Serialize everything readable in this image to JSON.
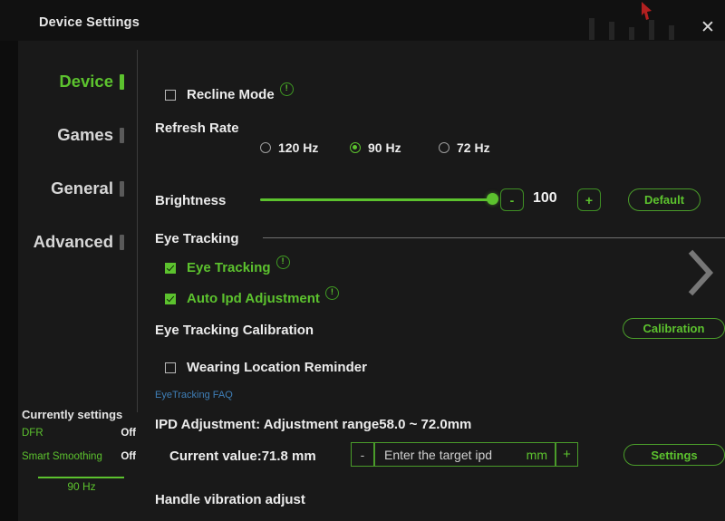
{
  "window": {
    "title": "Device Settings",
    "close_icon": "close-icon"
  },
  "colors": {
    "accent_green": "#5cc22e",
    "panel_bg": "#191919",
    "app_bg": "#0d0d0d",
    "text": "#ececec",
    "link_blue": "#3f7fb8"
  },
  "sidebar": {
    "items": [
      {
        "label": "Device",
        "active": true
      },
      {
        "label": "Games",
        "active": false
      },
      {
        "label": "General",
        "active": false
      },
      {
        "label": "Advanced",
        "active": false
      }
    ]
  },
  "current_settings": {
    "title": "Currently settings",
    "rows": [
      {
        "key": "DFR",
        "value": "Off"
      },
      {
        "key": "Smart Smoothing",
        "value": "Off"
      }
    ],
    "refresh_rate": "90 Hz"
  },
  "main": {
    "recline_mode": {
      "label": "Recline Mode",
      "checked": false,
      "info_icon": "info-icon"
    },
    "refresh_rate": {
      "label": "Refresh Rate",
      "options": [
        {
          "label": "120 Hz",
          "selected": false
        },
        {
          "label": "90 Hz",
          "selected": true
        },
        {
          "label": "72 Hz",
          "selected": false
        }
      ]
    },
    "brightness": {
      "label": "Brightness",
      "value": "100",
      "percent": 100,
      "minus_label": "-",
      "plus_label": "+",
      "default_label": "Default"
    },
    "eye_tracking_section": {
      "label": "Eye Tracking"
    },
    "eye_tracking_toggle": {
      "label": "Eye Tracking",
      "checked": true,
      "info_icon": "info-icon"
    },
    "auto_ipd": {
      "label": "Auto Ipd Adjustment",
      "checked": true,
      "info_icon": "info-icon"
    },
    "calibration": {
      "label": "Eye Tracking Calibration",
      "button_label": "Calibration"
    },
    "wearing_reminder": {
      "label": "Wearing Location Reminder",
      "checked": false
    },
    "faq_link": "EyeTracking FAQ",
    "ipd": {
      "heading": "IPD Adjustment: Adjustment range58.0 ~ 72.0mm",
      "current_value": "Current value:71.8 mm",
      "minus_label": "-",
      "plus_label": "+",
      "placeholder": "Enter the target ipd",
      "unit": "mm",
      "settings_label": "Settings"
    },
    "handle_vibration": {
      "label": "Handle vibration adjust"
    },
    "next_icon": "chevron-right-icon"
  }
}
